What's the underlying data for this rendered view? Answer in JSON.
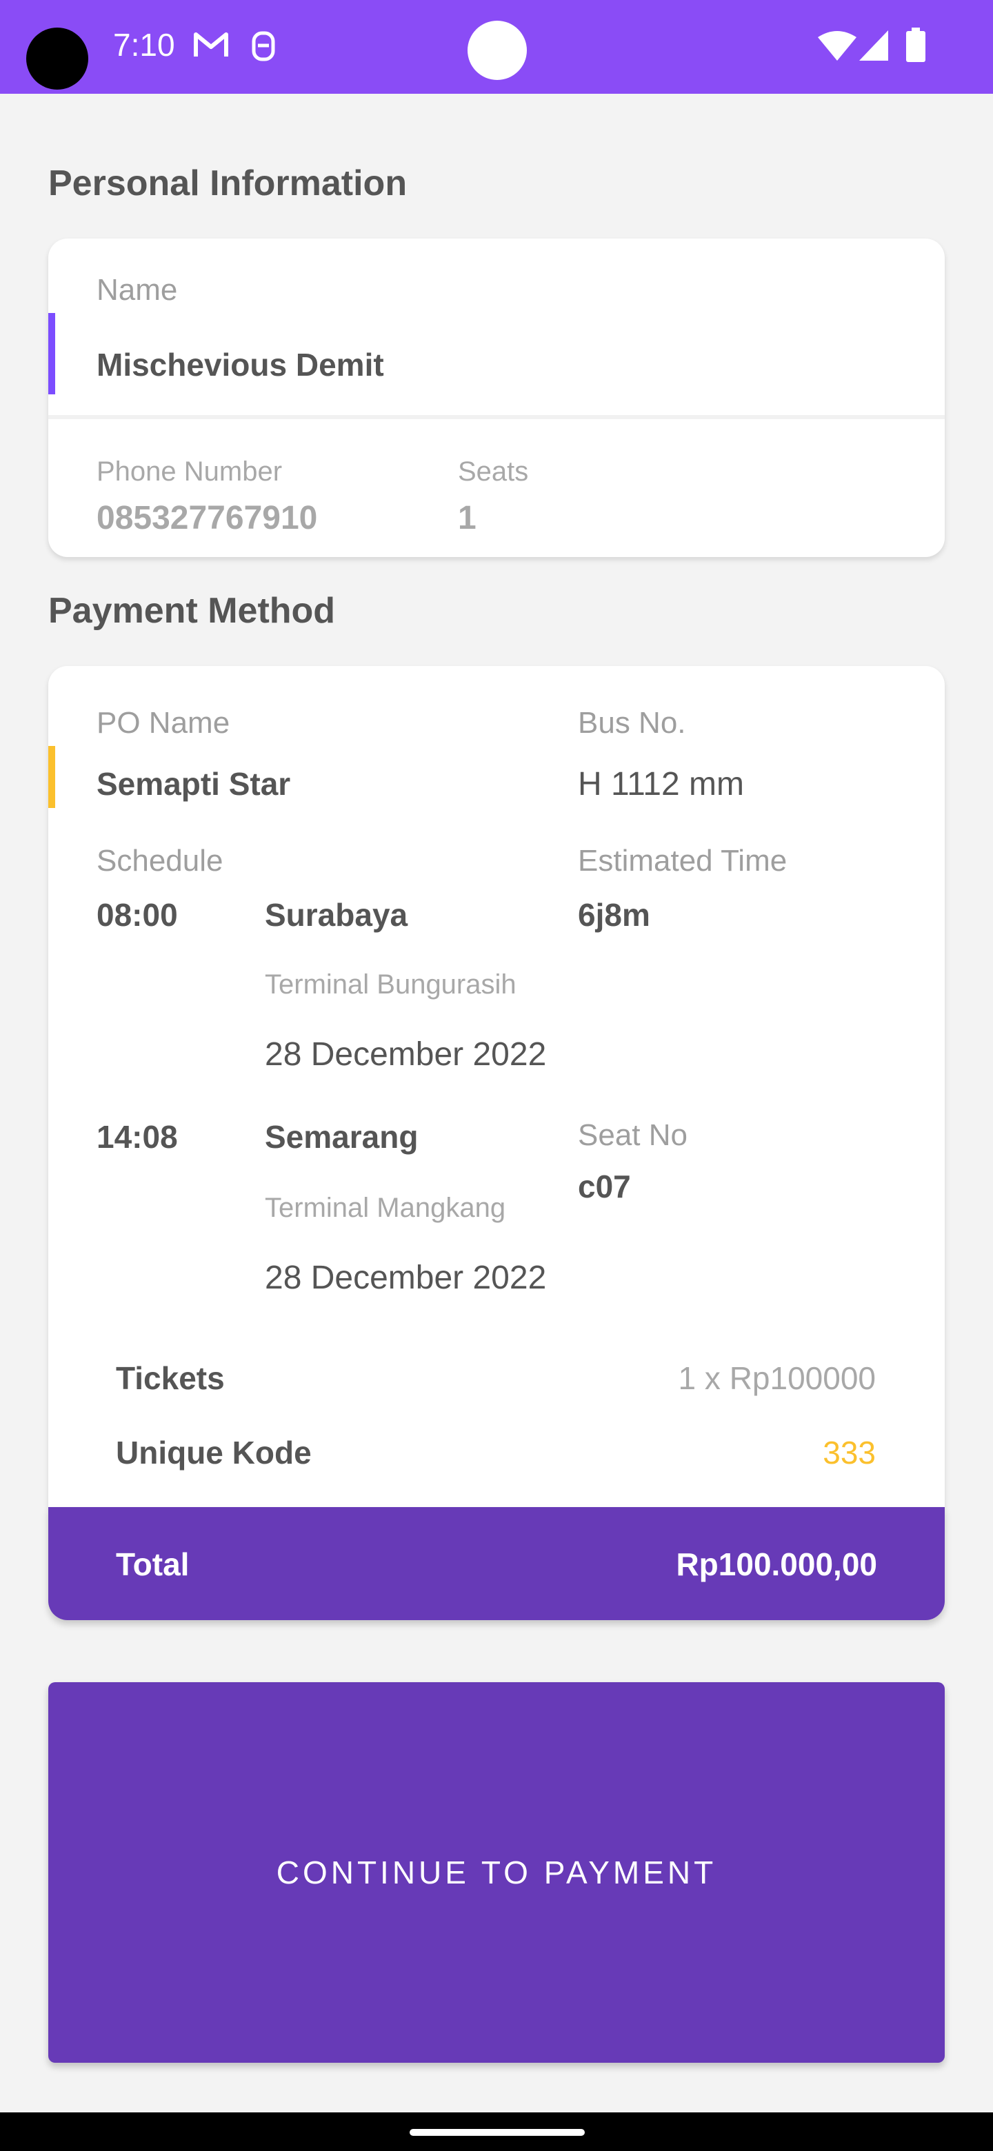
{
  "status_bar": {
    "time": "7:10",
    "icons": [
      "gmail-icon",
      "notification-icon",
      "wifi-icon",
      "signal-icon",
      "battery-icon"
    ],
    "color": "#8a4cf6"
  },
  "personal": {
    "title": "Personal Information",
    "name_label": "Name",
    "name_value": "Mischevious Demit",
    "phone_label": "Phone Number",
    "phone_value": "085327767910",
    "seats_label": "Seats",
    "seats_value": "1",
    "accent_color": "#7c4dff"
  },
  "payment": {
    "title": "Payment Method",
    "po_label": "PO Name",
    "po_value": "Semapti Star",
    "bus_label": "Bus No.",
    "bus_value": "H 1112 mm",
    "schedule_label": "Schedule",
    "est_label": "Estimated Time",
    "est_value": "6j8m",
    "departure": {
      "time": "08:00",
      "city": "Surabaya",
      "terminal": "Terminal Bungurasih",
      "date": "28 December 2022"
    },
    "arrival": {
      "time": "14:08",
      "city": "Semarang",
      "terminal": "Terminal Mangkang",
      "date": "28 December 2022"
    },
    "seat_label": "Seat No",
    "seat_value": "c07",
    "accent_color": "#fbc02d"
  },
  "summary": {
    "tickets_label": "Tickets",
    "tickets_value": "1 x Rp100000",
    "unique_label": "Unique Kode",
    "unique_value": "333",
    "unique_color": "#fbc02d",
    "total_label": "Total",
    "total_value": "Rp100.000,00"
  },
  "button": {
    "label": "CONTINUE TO PAYMENT",
    "color": "#673ab7"
  }
}
